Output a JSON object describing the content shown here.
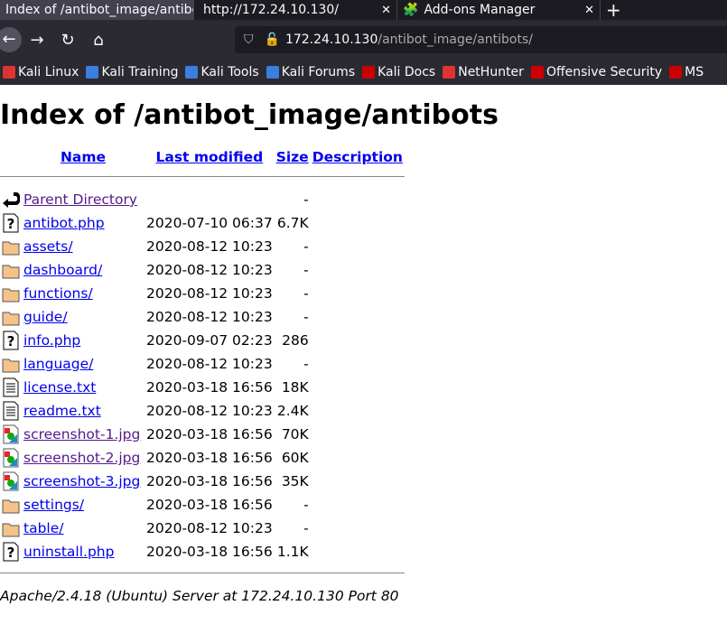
{
  "browser": {
    "tabs": [
      {
        "title": "Index of /antibot_image/antibots/",
        "active": true
      },
      {
        "title": "http://172.24.10.130/",
        "active": false
      },
      {
        "title": "Add-ons Manager",
        "active": false,
        "icon": "puzzle-icon"
      }
    ],
    "new_tab": "+",
    "close": "✕",
    "url_host": "172.24.10.130",
    "url_path": "/antibot_image/antibots/",
    "bookmarks": [
      {
        "label": "Kali Linux",
        "color": "#d33"
      },
      {
        "label": "Kali Training",
        "color": "#3a7ee0"
      },
      {
        "label": "Kali Tools",
        "color": "#3a7ee0"
      },
      {
        "label": "Kali Forums",
        "color": "#3a7ee0"
      },
      {
        "label": "Kali Docs",
        "color": "#c00"
      },
      {
        "label": "NetHunter",
        "color": "#d33"
      },
      {
        "label": "Offensive Security",
        "color": "#c00"
      },
      {
        "label": "MS",
        "color": "#c00"
      }
    ]
  },
  "page": {
    "title": "Index of /antibot_image/antibots",
    "headers": {
      "name": "Name",
      "modified": "Last modified",
      "size": "Size",
      "desc": "Description"
    },
    "rows": [
      {
        "name": "Parent Directory",
        "modified": "",
        "size": "-",
        "icon": "back",
        "visited": true
      },
      {
        "name": "antibot.php",
        "modified": "2020-07-10 06:37",
        "size": "6.7K",
        "icon": "unknown"
      },
      {
        "name": "assets/",
        "modified": "2020-08-12 10:23",
        "size": "-",
        "icon": "folder"
      },
      {
        "name": "dashboard/",
        "modified": "2020-08-12 10:23",
        "size": "-",
        "icon": "folder"
      },
      {
        "name": "functions/",
        "modified": "2020-08-12 10:23",
        "size": "-",
        "icon": "folder"
      },
      {
        "name": "guide/",
        "modified": "2020-08-12 10:23",
        "size": "-",
        "icon": "folder"
      },
      {
        "name": "info.php",
        "modified": "2020-09-07 02:23",
        "size": "286",
        "icon": "unknown"
      },
      {
        "name": "language/",
        "modified": "2020-08-12 10:23",
        "size": "-",
        "icon": "folder"
      },
      {
        "name": "license.txt",
        "modified": "2020-03-18 16:56",
        "size": "18K",
        "icon": "text"
      },
      {
        "name": "readme.txt",
        "modified": "2020-08-12 10:23",
        "size": "2.4K",
        "icon": "text"
      },
      {
        "name": "screenshot-1.jpg",
        "modified": "2020-03-18 16:56",
        "size": "70K",
        "icon": "image",
        "visited": true
      },
      {
        "name": "screenshot-2.jpg",
        "modified": "2020-03-18 16:56",
        "size": "60K",
        "icon": "image",
        "visited": true
      },
      {
        "name": "screenshot-3.jpg",
        "modified": "2020-03-18 16:56",
        "size": "35K",
        "icon": "image"
      },
      {
        "name": "settings/",
        "modified": "2020-03-18 16:56",
        "size": "-",
        "icon": "folder"
      },
      {
        "name": "table/",
        "modified": "2020-08-12 10:23",
        "size": "-",
        "icon": "folder"
      },
      {
        "name": "uninstall.php",
        "modified": "2020-03-18 16:56",
        "size": "1.1K",
        "icon": "unknown"
      }
    ],
    "footer": "Apache/2.4.18 (Ubuntu) Server at 172.24.10.130 Port 80"
  }
}
